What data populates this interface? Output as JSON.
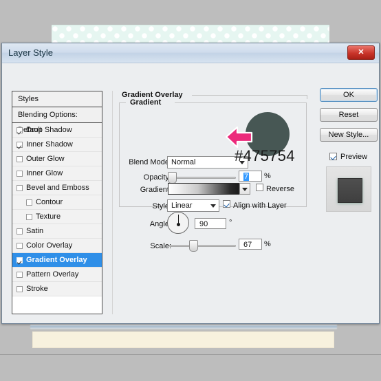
{
  "window": {
    "title": "Layer Style",
    "close_label": "✕"
  },
  "styles_list": {
    "header": "Styles",
    "blending_options": "Blending Options: Default",
    "items": [
      {
        "label": "Drop Shadow",
        "checked": true,
        "indent": false,
        "selected": false
      },
      {
        "label": "Inner Shadow",
        "checked": true,
        "indent": false,
        "selected": false
      },
      {
        "label": "Outer Glow",
        "checked": false,
        "indent": false,
        "selected": false
      },
      {
        "label": "Inner Glow",
        "checked": false,
        "indent": false,
        "selected": false
      },
      {
        "label": "Bevel and Emboss",
        "checked": false,
        "indent": false,
        "selected": false
      },
      {
        "label": "Contour",
        "checked": false,
        "indent": true,
        "selected": false
      },
      {
        "label": "Texture",
        "checked": false,
        "indent": true,
        "selected": false
      },
      {
        "label": "Satin",
        "checked": false,
        "indent": false,
        "selected": false
      },
      {
        "label": "Color Overlay",
        "checked": false,
        "indent": false,
        "selected": false
      },
      {
        "label": "Gradient Overlay",
        "checked": true,
        "indent": false,
        "selected": true
      },
      {
        "label": "Pattern Overlay",
        "checked": false,
        "indent": false,
        "selected": false
      },
      {
        "label": "Stroke",
        "checked": false,
        "indent": false,
        "selected": false
      }
    ]
  },
  "panel": {
    "title": "Gradient Overlay",
    "group_legend": "Gradient",
    "blend_mode": {
      "label": "Blend Mode:",
      "value": "Normal"
    },
    "opacity": {
      "label": "Opacity:",
      "value": "7",
      "unit": "%"
    },
    "gradient": {
      "label": "Gradient:",
      "reverse_label": "Reverse",
      "reverse_checked": false
    },
    "style": {
      "label": "Style:",
      "value": "Linear",
      "align_label": "Align with Layer",
      "align_checked": true
    },
    "angle": {
      "label": "Angle:",
      "value": "90",
      "unit": "°"
    },
    "scale": {
      "label": "Scale:",
      "value": "67",
      "unit": "%"
    }
  },
  "buttons": {
    "ok": "OK",
    "reset": "Reset",
    "new_style": "New Style...",
    "preview_label": "Preview",
    "preview_checked": true
  },
  "annotation": {
    "hex_label": "#475754",
    "circle_color": "#475754",
    "arrow_color": "#ec2a7b"
  },
  "colors": {
    "selection_blue": "#2f8fe8",
    "titlebar_blue": "#c3d3e6",
    "close_red": "#c9342a",
    "dots_mint": "#e6f6f1",
    "cream": "#f7f1de"
  }
}
